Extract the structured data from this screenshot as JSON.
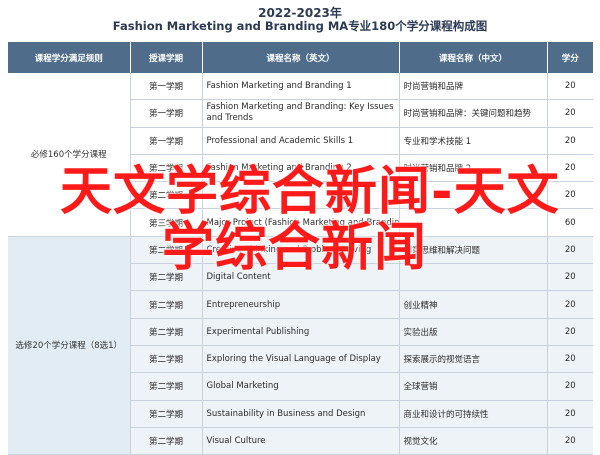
{
  "title_year": "2022-2023年",
  "title_main": "Fashion Marketing and Branding MA专业180个学分课程构成图",
  "headers": {
    "col1": "课程学分满足规则",
    "col2": "授课学期",
    "col3": "课程名称（英文）",
    "col4": "课程名称（中文）",
    "col5": "学分"
  },
  "groups": [
    {
      "label": "必修160个学分课程"
    },
    {
      "label": "选修20个学分课程（8选1）"
    }
  ],
  "rows": [
    {
      "sem": "第一学期",
      "en": "Fashion Marketing and Branding 1",
      "cn": "时尚营销和品牌",
      "credit": "20"
    },
    {
      "sem": "第一学期",
      "en": "Fashion Marketing and Branding: Key Issues and Trends",
      "cn": "时尚营销和品牌：关键问题和趋势",
      "credit": "20"
    },
    {
      "sem": "第一学期",
      "en": "Professional and Academic Skills 1",
      "cn": "专业和学术技能 1",
      "credit": "20"
    },
    {
      "sem": "第二学期",
      "en": "Fashion Marketing and Branding 2",
      "cn": "时尚营销和品牌 2",
      "credit": "20"
    },
    {
      "sem": "第二学期",
      "en": "",
      "cn": "",
      "credit": "20"
    },
    {
      "sem": "第三学期",
      "en": "Major Project (Fashion Marketing and Branding)",
      "cn": "",
      "credit": "60"
    },
    {
      "sem": "第二学期",
      "en": "Creative Thinking and Problem Solving",
      "cn": "创意思维和解决问题",
      "credit": "20"
    },
    {
      "sem": "第二学期",
      "en": "Digital Content",
      "cn": "",
      "credit": "20"
    },
    {
      "sem": "第二学期",
      "en": "Entrepreneurship",
      "cn": "创业精神",
      "credit": "20"
    },
    {
      "sem": "第二学期",
      "en": "Experimental Publishing",
      "cn": "实验出版",
      "credit": "20"
    },
    {
      "sem": "第二学期",
      "en": "Exploring the Visual Language of Display",
      "cn": "探索展示的视觉语言",
      "credit": "20"
    },
    {
      "sem": "第二学期",
      "en": "Global Marketing",
      "cn": "全球营销",
      "credit": "20"
    },
    {
      "sem": "第二学期",
      "en": "Sustainability in Business and Design",
      "cn": "商业和设计的可持续性",
      "credit": "20"
    },
    {
      "sem": "第二学期",
      "en": "Visual Culture",
      "cn": "视觉文化",
      "credit": "20"
    }
  ],
  "watermark_line1": "天文学综合新闻-天文",
  "watermark_line2": "学综合新闻"
}
